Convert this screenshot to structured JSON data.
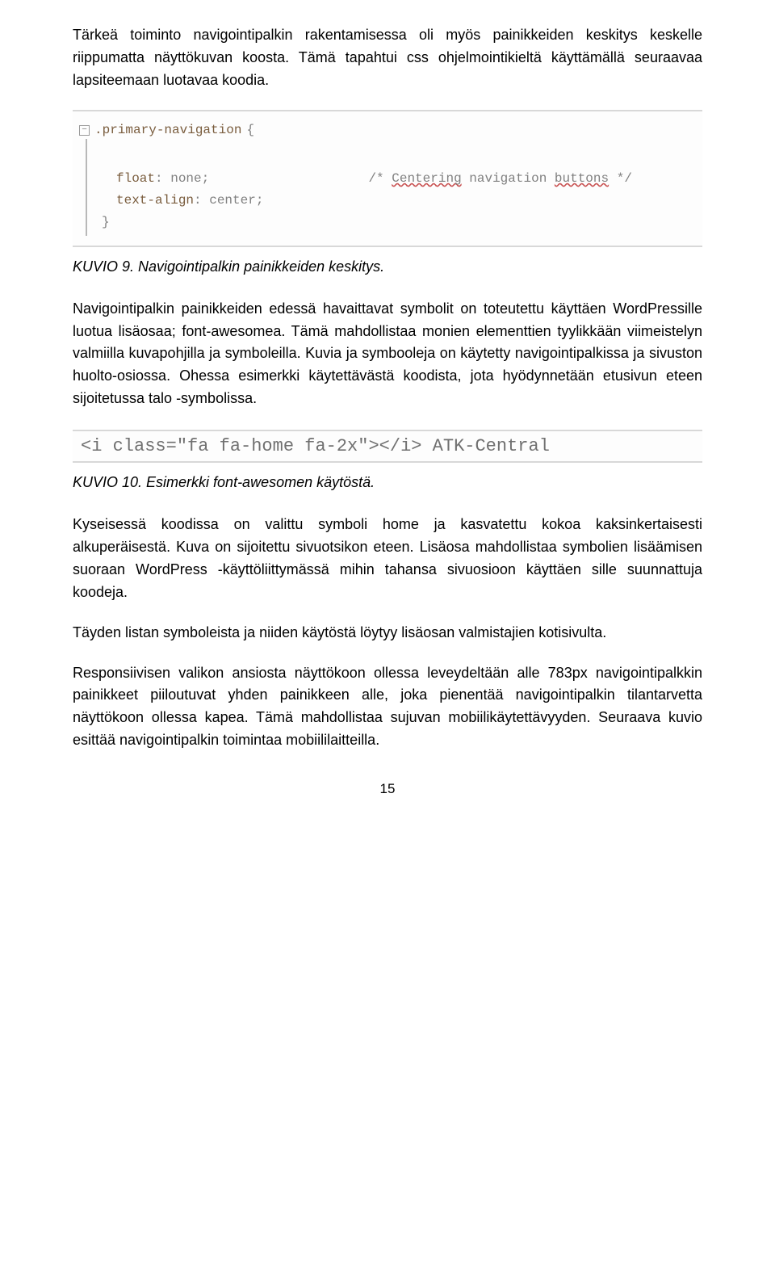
{
  "para1": "Tärkeä toiminto navigointipalkin rakentamisessa oli myös painikkeiden keskitys keskelle riippumatta näyttökuvan koosta. Tämä tapahtui css ohjelmointikieltä käyttämällä seuraavaa lapsiteemaan luotavaa koodia.",
  "fig9": {
    "selector": ".primary-navigation",
    "prop1_name": "float",
    "prop1_val": "none",
    "prop2_name": "text-align",
    "prop2_val": "center",
    "comment_prefix": "/* ",
    "comment_word1": "Centering",
    "comment_mid": " navigation ",
    "comment_word2": "buttons",
    "comment_suffix": " */",
    "open": "{",
    "close": "}"
  },
  "caption9": "KUVIO 9. Navigointipalkin painikkeiden keskitys.",
  "para2": "Navigointipalkin painikkeiden edessä havaittavat symbolit on toteutettu käyttäen WordPressille luotua lisäosaa; font-awesomea. Tämä mahdollistaa monien elementtien tyylikkään viimeistelyn valmiilla kuvapohjilla ja symboleilla. Kuvia ja symbooleja on käytetty navigointipalkissa ja sivuston huolto-osiossa. Ohessa esimerkki käytettävästä koodista, jota hyödynnetään etusivun eteen sijoitetussa talo -symbolissa.",
  "fig10": {
    "text": "<i class=\"fa fa-home fa-2x\"></i> ATK-Central"
  },
  "caption10": "KUVIO 10. Esimerkki font-awesomen käytöstä.",
  "para3": "Kyseisessä koodissa on valittu symboli home ja kasvatettu kokoa kaksinkertaisesti alkuperäisestä. Kuva on sijoitettu sivuotsikon eteen. Lisäosa mahdollistaa symbolien lisäämisen suoraan WordPress -käyttöliittymässä mihin tahansa sivuosioon käyttäen sille suunnattuja koodeja.",
  "para3b": "Täyden listan symboleista ja niiden käytöstä löytyy lisäosan valmistajien kotisivulta.",
  "para4": "Responsiivisen valikon ansiosta näyttökoon ollessa leveydeltään alle 783px navigointipalkkin painikkeet piiloutuvat yhden painikkeen alle, joka pienentää navigointipalkin tilantarvetta näyttökoon ollessa kapea. Tämä mahdollistaa sujuvan mobiilikäytettävyyden. Seuraava kuvio esittää navigointipalkin toimintaa mobiililaitteilla.",
  "pagenum": "15"
}
